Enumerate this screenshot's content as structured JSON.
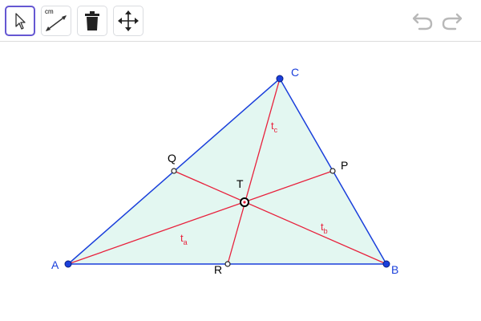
{
  "toolbar": {
    "tools": [
      {
        "name": "move-tool",
        "icon": "cursor-arrow-icon",
        "selected": true
      },
      {
        "name": "distance-tool",
        "icon": "measure-line-icon",
        "sublabel": "cm"
      },
      {
        "name": "delete-tool",
        "icon": "trash-icon"
      },
      {
        "name": "move-graphics-view-tool",
        "icon": "four-arrows-icon"
      }
    ],
    "undo_icon": "undo-arrow-icon",
    "redo_icon": "redo-arrow-icon"
  },
  "figure": {
    "vertices": {
      "A": "A",
      "B": "B",
      "C": "C"
    },
    "midpoints": {
      "P": "P",
      "Q": "Q",
      "R": "R"
    },
    "centroid": "T",
    "medians": {
      "ta": "t",
      "ta_sub": "a",
      "tb": "t",
      "tb_sub": "b",
      "tc": "t",
      "tc_sub": "c"
    }
  },
  "colors": {
    "triangle_edge": "#1a3fdb",
    "triangle_fill": "#e3f7f1",
    "median_line": "#e8213c",
    "vertex_point": "#1a3fdb",
    "accent_selected": "#6557d2"
  }
}
